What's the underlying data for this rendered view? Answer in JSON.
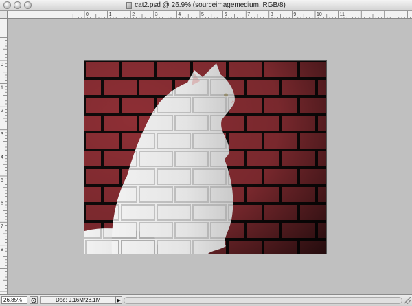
{
  "window": {
    "title": "cat2.psd @ 26.9% (sourceimagemedium, RGB/8)"
  },
  "ruler": {
    "top_labels": [
      "0",
      "1",
      "2",
      "3",
      "4",
      "5",
      "6",
      "7",
      "8",
      "9",
      "10",
      "11"
    ],
    "left_labels": [
      "0",
      "1",
      "2",
      "3",
      "4",
      "5",
      "6",
      "7",
      "8"
    ]
  },
  "canvas": {
    "background_color": "#c0c0c0",
    "brick_color": "#8e2f35",
    "mortar_color": "#0f0a0a",
    "subject": "white cat in front of brick wall"
  },
  "status": {
    "zoom": "26.85%",
    "doc_info": "Doc: 9.16M/28.1M",
    "arrow": "▶"
  },
  "icons": {
    "close": "close-button-icon",
    "minimize": "minimize-button-icon",
    "zoom": "zoom-button-icon",
    "document": "psd-document-icon",
    "status_menu": "status-menu-icon"
  }
}
